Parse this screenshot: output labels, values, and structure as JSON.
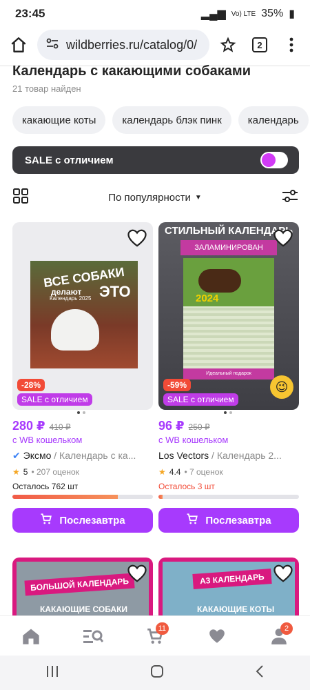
{
  "status": {
    "time": "23:45",
    "signal_text": "Vo) LTE",
    "battery": "35%"
  },
  "browser": {
    "url": "wildberries.ru/catalog/0/",
    "tabs": "2"
  },
  "page": {
    "title": "Календарь с какающими собаками",
    "count": "21 товар найден"
  },
  "chips": [
    "какающие коты",
    "календарь блэк пинк",
    "календарь"
  ],
  "sale_filter": {
    "label": "SALE с отличием",
    "enabled": true
  },
  "sort": {
    "label": "По популярности"
  },
  "products": [
    {
      "image_text": {
        "line1": "ВСЕ СОБАКИ",
        "line2": "делают",
        "line3": "ЭТО",
        "line4": "Календарь 2025"
      },
      "discount": "-28%",
      "sale_badge": "SALE с отличием",
      "price": "280 ₽",
      "old_price": "410 ₽",
      "wallet": "с WB кошельком",
      "brand": "Эксмо",
      "desc": " / Календарь с ка...",
      "rating": "5",
      "reviews": "• 207 оценок",
      "stock": "Осталось 762 шт",
      "stock_level": 0.75,
      "buy": "Послезавтра"
    },
    {
      "image_text": {
        "line1": "СТИЛЬНЫЙ КАЛЕНДАРЬ",
        "line2": "ЗАЛАМИНИРОВАН",
        "line3": "2024",
        "line4": "Идеальный подарок"
      },
      "discount": "-59%",
      "sale_badge": "SALE с отличием",
      "price": "96 ₽",
      "old_price": "250 ₽",
      "wallet": "с WB кошельком",
      "brand": "Los Vectors",
      "desc": " / Календарь 2...",
      "rating": "4.4",
      "reviews": "• 7 оценок",
      "stock": "Осталось 3 шт",
      "stock_level": 0.03,
      "buy": "Послезавтра"
    }
  ],
  "next_products": [
    {
      "banner": "БОЛЬШОЙ КАЛЕНДАРЬ",
      "sub": "КАКАЮЩИЕ СОБАКИ"
    },
    {
      "banner": "А3 КАЛЕНДАРЬ",
      "sub": "КАКАЮЩИЕ КОТЫ"
    }
  ],
  "nav": {
    "cart_badge": "11",
    "profile_badge": "2"
  },
  "colors": {
    "accent": "#a73afd",
    "sale_bar": "#3a3a3e",
    "discount": "#f24b37"
  }
}
